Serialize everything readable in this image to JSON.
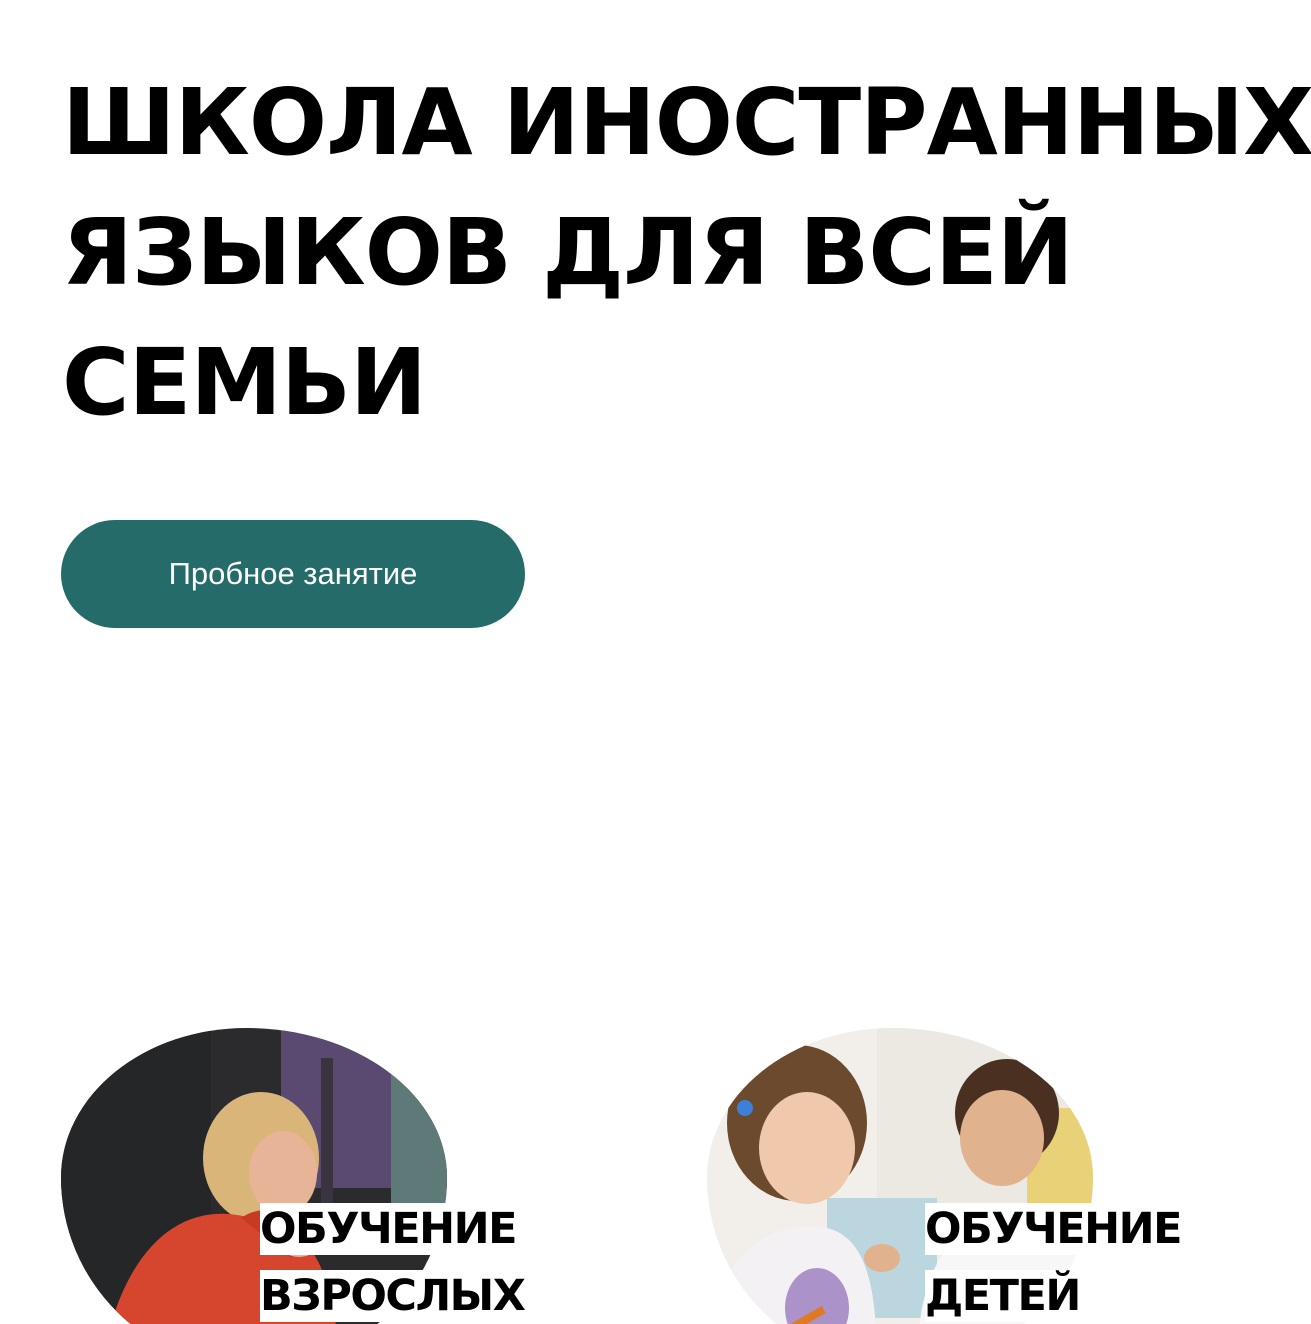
{
  "hero": {
    "title_lines": [
      "ШКОЛА ИНОСТРАННЫХ",
      "ЯЗЫКОВ ДЛЯ ВСЕЙ",
      "СЕМЬИ"
    ],
    "cta_label": "Пробное занятие"
  },
  "cards": [
    {
      "label_lines": [
        "ОБУЧЕНИЕ",
        "ВЗРОСЛЫХ"
      ],
      "photo": "adult-woman-studying-photo"
    },
    {
      "label_lines": [
        "ОБУЧЕНИЕ",
        "ДЕТЕЙ"
      ],
      "photo": "children-drawing-photo"
    }
  ],
  "colors": {
    "accent": "#256b69",
    "text": "#000000",
    "background": "#ffffff"
  }
}
